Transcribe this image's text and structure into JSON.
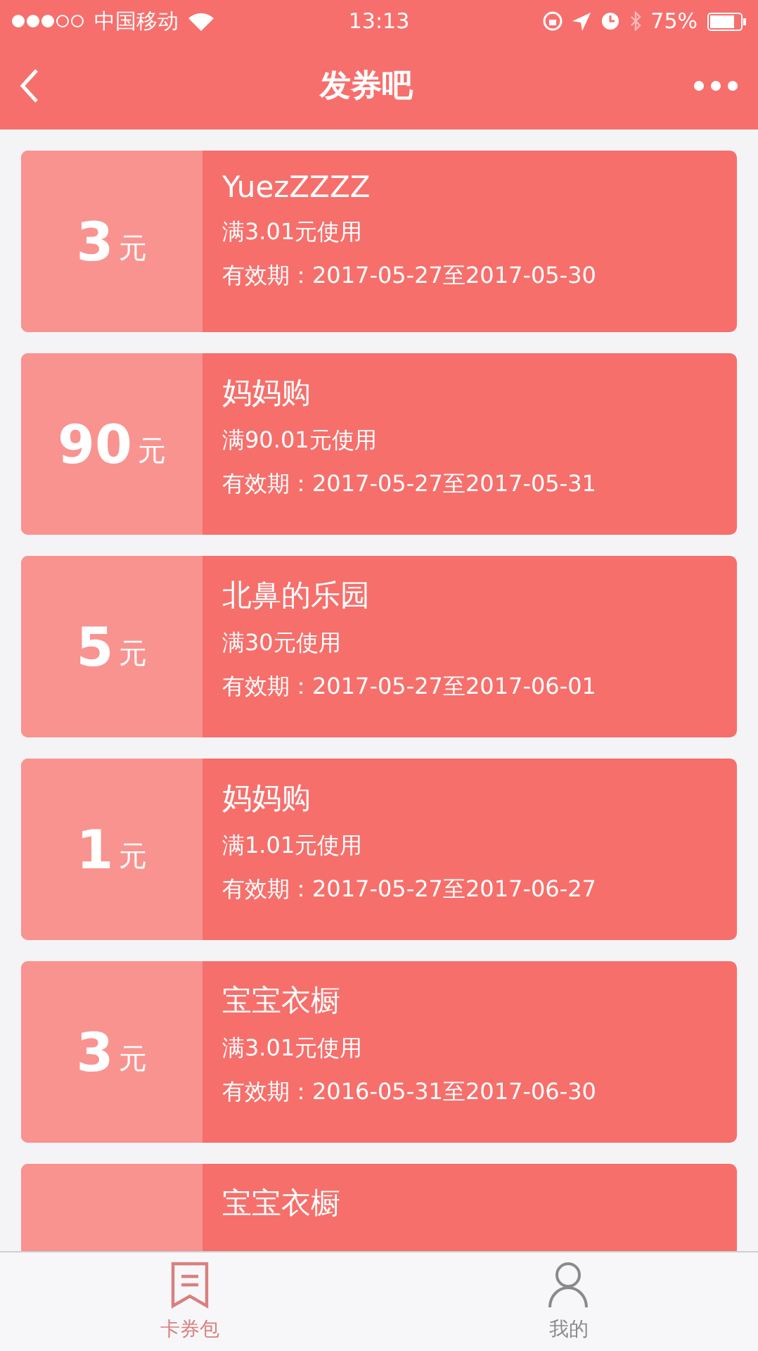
{
  "status_bar": {
    "carrier": "中国移动",
    "time": "13:13",
    "battery": "75%"
  },
  "nav": {
    "title": "发券吧"
  },
  "coupons": [
    {
      "amount": "3",
      "unit": "元",
      "title": "YuezZZZZ",
      "condition": "满3.01元使用",
      "validity": "有效期：2017-05-27至2017-05-30"
    },
    {
      "amount": "90",
      "unit": "元",
      "title": "妈妈购",
      "condition": "满90.01元使用",
      "validity": "有效期：2017-05-27至2017-05-31"
    },
    {
      "amount": "5",
      "unit": "元",
      "title": "北鼻的乐园",
      "condition": "满30元使用",
      "validity": "有效期：2017-05-27至2017-06-01"
    },
    {
      "amount": "1",
      "unit": "元",
      "title": "妈妈购",
      "condition": "满1.01元使用",
      "validity": "有效期：2017-05-27至2017-06-27"
    },
    {
      "amount": "3",
      "unit": "元",
      "title": "宝宝衣橱",
      "condition": "满3.01元使用",
      "validity": "有效期：2016-05-31至2017-06-30"
    },
    {
      "title": "宝宝衣橱"
    }
  ],
  "tabs": [
    {
      "label": "卡券包",
      "kind": "coupons",
      "selected": true
    },
    {
      "label": "我的",
      "kind": "profile",
      "selected": false
    }
  ]
}
